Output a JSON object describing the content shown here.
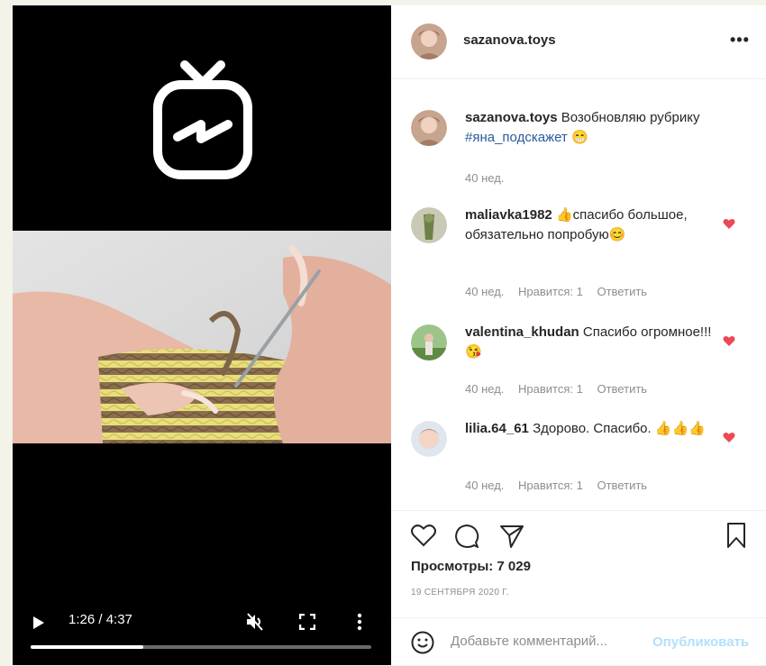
{
  "video": {
    "time": "1:26 / 4:37",
    "progress": 0.33,
    "icons": [
      "igtv-logo",
      "play-icon",
      "mute-icon",
      "fullscreen-icon",
      "more-vertical-icon"
    ]
  },
  "header": {
    "username": "sazanova.toys"
  },
  "caption": {
    "username": "sazanova.toys",
    "text": "Возобновляю рубрику",
    "hashtag": "#яна_подскажет",
    "emoji": "😁",
    "time": "40 нед."
  },
  "comments": [
    {
      "username": "maliavka1982",
      "text": "👍спасибо большое, обязательно попробую😊",
      "time": "40 нед.",
      "likes": "Нравится: 1",
      "reply": "Ответить"
    },
    {
      "username": "valentina_khudan",
      "text": "Спасибо огромное!!! 😘",
      "time": "40 нед.",
      "likes": "Нравится: 1",
      "reply": "Ответить"
    },
    {
      "username": "lilia.64_61",
      "text": "Здорово. Спасибо. 👍👍👍",
      "time": "40 нед.",
      "likes": "Нравится: 1",
      "reply": "Ответить"
    }
  ],
  "stats": {
    "views": "Просмотры: 7 029",
    "date": "19 СЕНТЯБРЯ 2020 Г."
  },
  "add_comment": {
    "placeholder": "Добавьте комментарий...",
    "post": "Опубликовать"
  },
  "colors": {
    "like_red": "#ed4956",
    "link_blue": "#2b5a9b",
    "post_blue": "#b2dffc"
  }
}
